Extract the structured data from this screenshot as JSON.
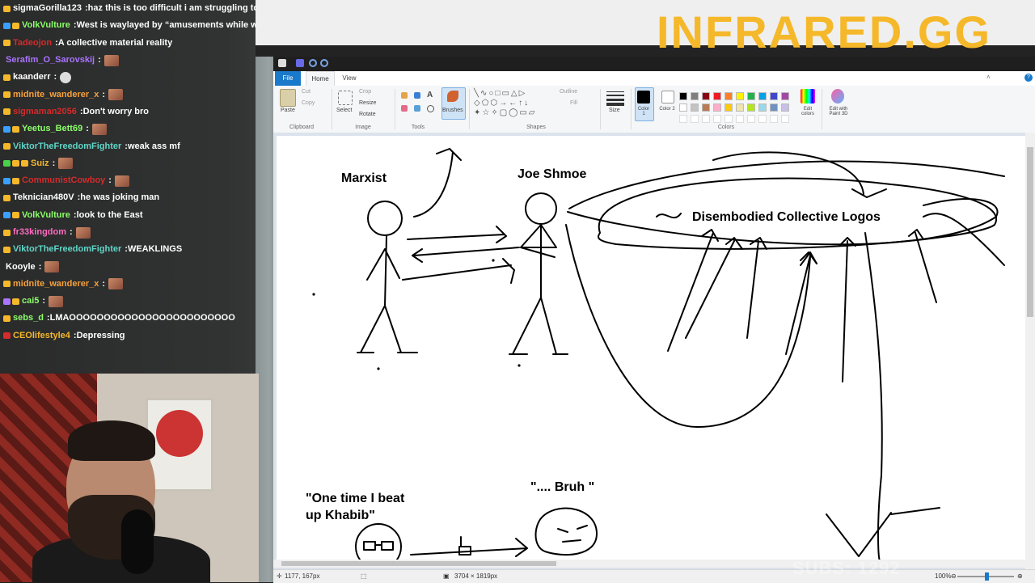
{
  "brand": {
    "title": "INFRARED.GG",
    "color": "#f5b82a"
  },
  "chat": {
    "messages": [
      {
        "user": "sigmaGorilla123",
        "color": "#ffffff",
        "text": "haz this is too difficult i am struggling to c",
        "badges": [
          "#f5b82a"
        ]
      },
      {
        "user": "VolkVulture",
        "color": "#8cff6a",
        "text": "West is waylayed by “amusements while wa",
        "badges": [
          "#3aa0ff",
          "#f5b82a"
        ]
      },
      {
        "user": "Tadeojon",
        "color": "#d42b2b",
        "text": "A collective material reality",
        "badges": [
          "#f5b82a"
        ]
      },
      {
        "user": "Serafim_O_Sarovskij",
        "color": "#a974ff",
        "text": "",
        "badges": [],
        "emote": true
      },
      {
        "user": "kaanderr",
        "color": "#ffffff",
        "text": "",
        "badges": [
          "#f5b82a"
        ],
        "skull": true
      },
      {
        "user": "midnite_wanderer_x",
        "color": "#f5a13b",
        "text": "",
        "badges": [
          "#f5b82a"
        ],
        "emote": true
      },
      {
        "user": "sigmaman2056",
        "color": "#d42b2b",
        "text": "Don't worry bro",
        "badges": [
          "#f5b82a"
        ]
      },
      {
        "user": "Yeetus_Bett69",
        "color": "#8cff6a",
        "text": "",
        "badges": [
          "#3aa0ff",
          "#f5b82a"
        ],
        "emote": true
      },
      {
        "user": "ViktorTheFreedomFighter",
        "color": "#5fd6c8",
        "text": "weak ass mf",
        "badges": [
          "#f5b82a"
        ]
      },
      {
        "user": "Suiz",
        "color": "#f5b82a",
        "text": "",
        "badges": [
          "#4ad14a",
          "#f5b82a",
          "#f5b82a"
        ],
        "emote": true
      },
      {
        "user": "CommunistCowboy",
        "color": "#d42b2b",
        "text": "",
        "badges": [
          "#3aa0ff",
          "#f5b82a"
        ],
        "emote": true
      },
      {
        "user": "Teknician480V",
        "color": "#ffffff",
        "text": "he was joking man",
        "badges": [
          "#f5b82a"
        ]
      },
      {
        "user": "VolkVulture",
        "color": "#8cff6a",
        "text": "look to the East",
        "badges": [
          "#3aa0ff",
          "#f5b82a"
        ]
      },
      {
        "user": "fr33kingdom",
        "color": "#ff6ac1",
        "text": "",
        "badges": [
          "#f5b82a"
        ],
        "emote": true
      },
      {
        "user": "ViktorTheFreedomFighter",
        "color": "#5fd6c8",
        "text": "WEAKLINGS",
        "badges": [
          "#f5b82a"
        ]
      },
      {
        "user": "Kooyle",
        "color": "#ffffff",
        "text": "",
        "badges": [],
        "emote": true
      },
      {
        "user": "midnite_wanderer_x",
        "color": "#f5a13b",
        "text": "",
        "badges": [
          "#f5b82a"
        ],
        "emote": true
      },
      {
        "user": "cai5",
        "color": "#8cff6a",
        "text": "",
        "badges": [
          "#a974ff",
          "#f5b82a"
        ],
        "emote": true
      },
      {
        "user": "sebs_d",
        "color": "#8cff6a",
        "text": "LMAOOOOOOOOOOOOOOOOOOOOOOOO",
        "badges": [
          "#f5b82a"
        ]
      },
      {
        "user": "CEOlifestyle4",
        "color": "#f5b82a",
        "text": "Depressing",
        "badges": [
          "#d42b2b"
        ]
      }
    ]
  },
  "paint": {
    "menu": {
      "file": "File",
      "home": "Home",
      "view": "View"
    },
    "ribbon": {
      "clipboard": {
        "label": "Clipboard",
        "paste": "Paste",
        "cut": "Cut",
        "copy": "Copy"
      },
      "image": {
        "label": "Image",
        "select": "Select",
        "crop": "Crop",
        "resize": "Resize",
        "rotate": "Rotate"
      },
      "tools": {
        "label": "Tools"
      },
      "brushes": {
        "label": "Brushes"
      },
      "shapes": {
        "label": "Shapes",
        "outline": "Outline",
        "fill": "Fill"
      },
      "size": {
        "label": "Size"
      },
      "colors": {
        "label": "Colors",
        "color1": "Color 1",
        "color2": "Color 2",
        "edit": "Edit colors",
        "paint3d": "Edit with Paint 3D",
        "palette_row1": [
          "#000000",
          "#7f7f7f",
          "#880015",
          "#ed1c24",
          "#ff7f27",
          "#fff200",
          "#22b14c",
          "#00a2e8",
          "#3f48cc",
          "#a349a4"
        ],
        "palette_row2": [
          "#ffffff",
          "#c3c3c3",
          "#b97a57",
          "#ffaec9",
          "#ffc90e",
          "#efe4b0",
          "#b5e61d",
          "#99d9ea",
          "#7092be",
          "#c8bfe7"
        ]
      }
    },
    "drawing": {
      "marxist": "Marxist",
      "joe": "Joe Shmoe",
      "logos": "Disembodied Collective Logos",
      "quote1_line1": "\"One time I beat",
      "quote1_line2": "up Khabib\"",
      "quote2": "\".... Bruh \""
    },
    "status": {
      "cursor": "1177, 167px",
      "canvas_size": "3704 × 1819px",
      "zoom": "100%"
    }
  },
  "overlay": {
    "subs": "SUBS: 1292"
  }
}
